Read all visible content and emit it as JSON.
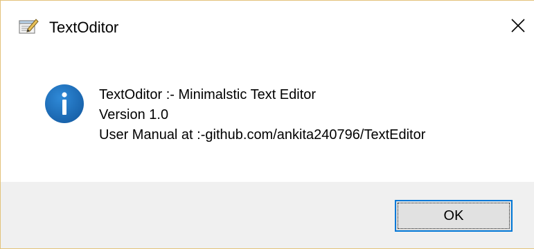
{
  "window": {
    "title": "TextOditor",
    "app_icon": "notepad-icon",
    "close_icon": "close-icon"
  },
  "dialog": {
    "icon": "info-icon",
    "message_lines": [
      "TextOditor :- Minimalstic Text Editor",
      "Version 1.0",
      "User Manual at :-github.com/ankita240796/TextEditor"
    ],
    "ok_label": "OK"
  },
  "colors": {
    "info_icon": "#1e73be",
    "ok_border": "#0078d7",
    "footer_bg": "#f0f0f0",
    "window_border": "#e3c27a"
  }
}
